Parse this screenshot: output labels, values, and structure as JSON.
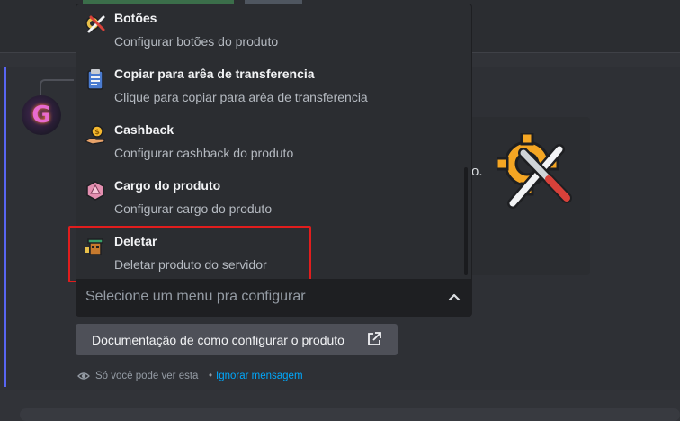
{
  "menu": {
    "options": [
      {
        "label": "Botões",
        "description": "Configurar botões do produto",
        "icon": "gears-buttons-icon"
      },
      {
        "label": "Copiar para arêa de transferencia",
        "description": "Clique para copiar para arêa de transferencia",
        "icon": "clipboard-icon"
      },
      {
        "label": "Cashback",
        "description": "Configurar cashback do produto",
        "icon": "coin-hand-icon"
      },
      {
        "label": "Cargo do produto",
        "description": "Configurar cargo do produto",
        "icon": "gem-role-icon"
      },
      {
        "label": "Deletar",
        "description": "Deletar produto do servidor",
        "icon": "trash-character-icon"
      }
    ],
    "highlighted": "Deletar"
  },
  "select": {
    "placeholder": "Selecione um menu pra configurar"
  },
  "doc_button": {
    "label": "Documentação de como configurar o produto",
    "icon": "external-link-icon"
  },
  "ephemeral": {
    "text": "Só você pode ver esta",
    "separator": "•",
    "link": "Ignorar mensagem",
    "icon": "eye-icon"
  },
  "embed": {
    "trailing_text": "o."
  },
  "avatar": {
    "letter": "G"
  },
  "colors": {
    "accent": "#5865f2",
    "highlight_border": "#e11d1d",
    "link": "#00a8fc"
  }
}
